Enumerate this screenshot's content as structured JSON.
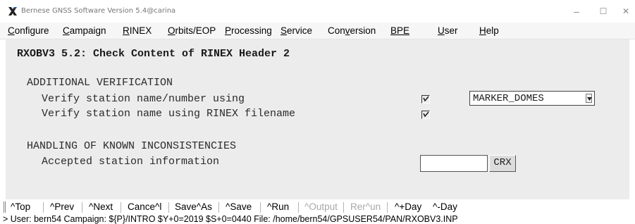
{
  "window": {
    "title": "Bernese GNSS Software Version 5.4@carina",
    "app_icon": "x-logo-icon",
    "controls": {
      "minimize": "–",
      "maximize": "☐",
      "close": "✕"
    }
  },
  "menubar": {
    "items": [
      {
        "label": "Configure"
      },
      {
        "label": "Campaign"
      },
      {
        "label": "RINEX"
      },
      {
        "label": "Orbits/EOP"
      },
      {
        "label": "Processing"
      },
      {
        "label": "Service"
      },
      {
        "label": "Conversion"
      },
      {
        "label": "BPE"
      },
      {
        "label": "User"
      },
      {
        "label": "Help"
      }
    ]
  },
  "panel": {
    "title": "RXOBV3 5.2: Check Content of RINEX Header 2",
    "section1": {
      "heading": "ADDITIONAL VERIFICATION",
      "row1_label": "Verify station name/number using",
      "row1_checked": true,
      "row1_select_value": "MARKER_DOMES",
      "row2_label": "Verify station name using RINEX filename",
      "row2_checked": true
    },
    "section2": {
      "heading": "HANDLING OF KNOWN INCONSISTENCIES",
      "row1_label": "Accepted station information",
      "row1_value": "",
      "row1_button": "CRX"
    }
  },
  "toolbar": {
    "items": [
      {
        "label": "^Top",
        "enabled": true
      },
      {
        "label": "^Prev",
        "enabled": true
      },
      {
        "label": "^Next",
        "enabled": true
      },
      {
        "label": "Cance^l",
        "enabled": true
      },
      {
        "label": "Save^As",
        "enabled": true
      },
      {
        "label": "^Save",
        "enabled": true
      },
      {
        "label": "^Run",
        "enabled": true
      },
      {
        "label": "^Output",
        "enabled": false
      },
      {
        "label": "Rer^un",
        "enabled": false
      },
      {
        "label": "^+Day",
        "enabled": true
      },
      {
        "label": "^-Day",
        "enabled": true
      }
    ]
  },
  "status": {
    "text": "> User: bern54  Campaign: ${P}/INTRO  $Y+0=2019  $S+0=0440  File: /home/bern54/GPSUSER54/PAN/RXOBV3.INP"
  }
}
